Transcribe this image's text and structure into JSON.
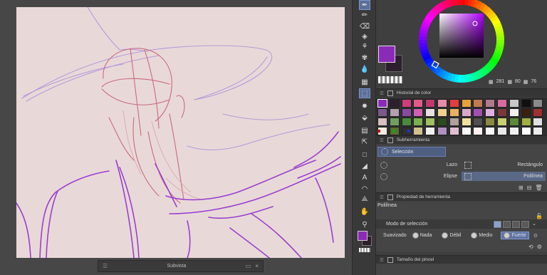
{
  "subview": {
    "title": "Subvista",
    "grip": "☰",
    "close": "×"
  },
  "toolbar": {
    "tools": [
      {
        "name": "pen-nib-icon",
        "glyph": "✒",
        "active": true
      },
      {
        "name": "pencil-icon",
        "glyph": "✏",
        "active": false
      },
      {
        "name": "eraser-icon",
        "glyph": "⌫",
        "active": false
      },
      {
        "name": "fill-icon",
        "glyph": "◈",
        "active": false
      },
      {
        "name": "airbrush-icon",
        "glyph": "⚘",
        "active": false
      },
      {
        "name": "decoration-icon",
        "glyph": "✾",
        "active": false
      },
      {
        "name": "blend-icon",
        "glyph": "💧",
        "active": false
      },
      {
        "name": "frame-icon",
        "glyph": "▦",
        "active": false
      },
      {
        "name": "selection-tool-icon",
        "glyph": "⬚",
        "active": true
      },
      {
        "name": "auto-select-icon",
        "glyph": "✸",
        "active": false
      },
      {
        "name": "fill-bucket-icon",
        "glyph": "⬙",
        "active": false
      },
      {
        "name": "gradient-icon",
        "glyph": "▤",
        "active": false
      },
      {
        "name": "object-icon",
        "glyph": "⇱",
        "active": false
      },
      {
        "name": "figure-icon",
        "glyph": "□",
        "active": false
      },
      {
        "name": "ruler-icon",
        "glyph": "◢",
        "active": false
      },
      {
        "name": "text-icon",
        "glyph": "A",
        "active": false
      },
      {
        "name": "balloon-icon",
        "glyph": "◠",
        "active": false
      },
      {
        "name": "correct-line-icon",
        "glyph": "⟁",
        "active": false
      },
      {
        "name": "hand-icon",
        "glyph": "✋",
        "active": false
      },
      {
        "name": "eyedropper-icon",
        "glyph": "⚲",
        "active": false
      }
    ]
  },
  "colorwheel": {
    "hsv": {
      "h_label": "281",
      "s_label": "80",
      "v_label": "76"
    },
    "main_color": "#8b2ab9",
    "sub_color": "#2e1f2e"
  },
  "palette": {
    "title": "Historial de color",
    "colors": [
      "#8b2ab9",
      "#2e1f2e",
      "#d13c7a",
      "#e05a8a",
      "#c03a6d",
      "#e98aa8",
      "#e23c3c",
      "#e6a23a",
      "#c27a52",
      "#b07a8a",
      "#d86aa0",
      "#c8c8c8",
      "#101010",
      "#8a8a8a",
      "#7a5a8a",
      "#b0a0b0",
      "#8a4aa0",
      "#d060b0",
      "#e8e0e0",
      "#f0d090",
      "#e8b060",
      "#d8a8c8",
      "#a050b0",
      "#e0b0e0",
      "#7a3a3a",
      "#f0f0f0",
      "#3a2010",
      "#a03030",
      "#d8c0c0",
      "#70a060",
      "#4a8a3a",
      "#7ab050",
      "#a0c060",
      "#2a4a20",
      "#b0a0a0",
      "#f0e0a0",
      "#505050",
      "#8a8a40",
      "#c8d070",
      "#5a8a3a",
      "#a0b040",
      "#e0e0e0",
      "#f4ece0",
      "#5a7030",
      "#303030",
      "#d0c090",
      "#f0f0f0",
      "#b090c0",
      "#e0c0d0",
      "#fafafa",
      "#fff0f0",
      "#f8f8f8",
      "#e8e8e8",
      "#f0f0f0",
      "#ffffff",
      "#ececec"
    ],
    "markers": [
      "#b01818",
      "#18a018",
      "#1838c0"
    ]
  },
  "subtool": {
    "title": "Subherramienta",
    "tab": "Selección",
    "items": {
      "lasso": "Lazo",
      "rect": "Rectángulo",
      "ellipse": "Elipse",
      "polyline": "Polilínea"
    }
  },
  "toolprop": {
    "title": "Propiedad de herramienta",
    "name": "Polilínea",
    "mode_label": "Modo de selección",
    "aa_label": "Suavizado",
    "aa_options": {
      "none": "Nada",
      "weak": "Débil",
      "medium": "Medio",
      "strong": "Fuerte"
    }
  },
  "brushsize": {
    "title": "Tamaño del pincel"
  }
}
